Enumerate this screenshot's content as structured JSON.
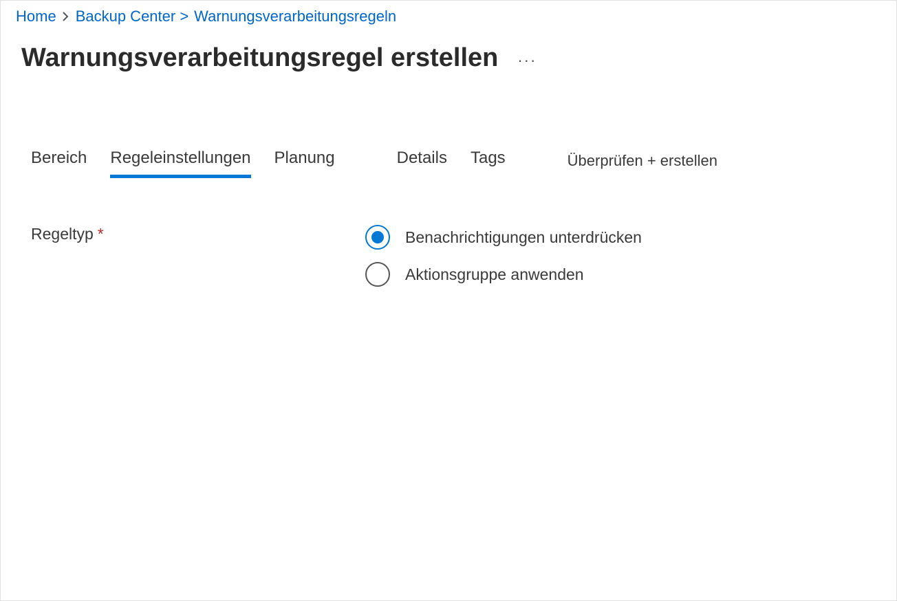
{
  "breadcrumb": {
    "home": "Home",
    "backup_center": "Backup Center >",
    "rules": "Warnungsverarbeitungsregeln"
  },
  "page_title": "Warnungsverarbeitungsregel erstellen",
  "more_actions": "···",
  "tabs": {
    "bereich": "Bereich",
    "regeleinstellungen": "Regeleinstellungen",
    "planung": "Planung",
    "details": "Details",
    "tags": "Tags",
    "review": "Überprüfen + erstellen"
  },
  "form": {
    "rule_type_label": "Regeltyp",
    "required_mark": "*",
    "options": {
      "suppress": "Benachrichtigungen unterdrücken",
      "apply_action_group": "Aktionsgruppe anwenden"
    }
  }
}
